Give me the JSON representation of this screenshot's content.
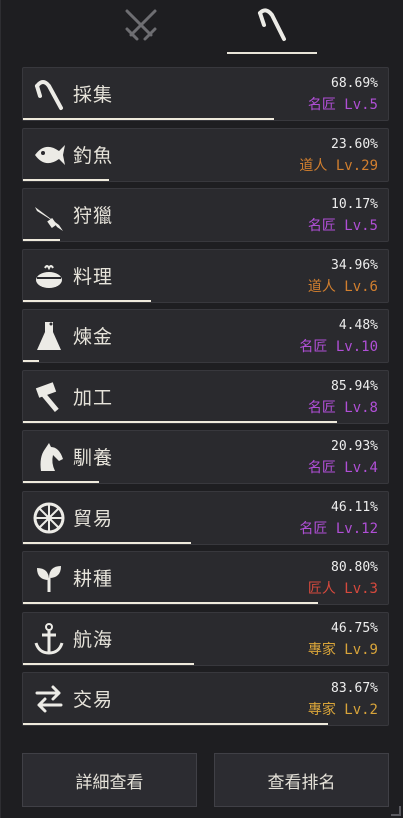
{
  "tabs": [
    {
      "icon": "crossed-swords-icon",
      "active": false
    },
    {
      "icon": "sickle-icon",
      "active": true
    }
  ],
  "skills": [
    {
      "name": "採集",
      "icon": "sickle-icon",
      "percent": "68.69%",
      "progress": 0.6869,
      "rank": "名匠 Lv.5",
      "rank_color": "#b04fd6"
    },
    {
      "name": "釣魚",
      "icon": "fish-icon",
      "percent": "23.60%",
      "progress": 0.236,
      "rank": "道人 Lv.29",
      "rank_color": "#d27f2e"
    },
    {
      "name": "狩獵",
      "icon": "musket-icon",
      "percent": "10.17%",
      "progress": 0.1017,
      "rank": "名匠 Lv.5",
      "rank_color": "#b04fd6"
    },
    {
      "name": "料理",
      "icon": "cooking-pot-icon",
      "percent": "34.96%",
      "progress": 0.3496,
      "rank": "道人 Lv.6",
      "rank_color": "#d27f2e"
    },
    {
      "name": "煉金",
      "icon": "flask-icon",
      "percent": "4.48%",
      "progress": 0.0448,
      "rank": "名匠 Lv.10",
      "rank_color": "#b04fd6"
    },
    {
      "name": "加工",
      "icon": "hammer-icon",
      "percent": "85.94%",
      "progress": 0.8594,
      "rank": "名匠 Lv.8",
      "rank_color": "#b04fd6"
    },
    {
      "name": "馴養",
      "icon": "horse-head-icon",
      "percent": "20.93%",
      "progress": 0.2093,
      "rank": "名匠 Lv.4",
      "rank_color": "#b04fd6"
    },
    {
      "name": "貿易",
      "icon": "wagon-wheel-icon",
      "percent": "46.11%",
      "progress": 0.4611,
      "rank": "名匠 Lv.12",
      "rank_color": "#b04fd6"
    },
    {
      "name": "耕種",
      "icon": "sprout-icon",
      "percent": "80.80%",
      "progress": 0.808,
      "rank": "匠人 Lv.3",
      "rank_color": "#d6493d"
    },
    {
      "name": "航海",
      "icon": "anchor-icon",
      "percent": "46.75%",
      "progress": 0.4675,
      "rank": "專家 Lv.9",
      "rank_color": "#d8a43a"
    },
    {
      "name": "交易",
      "icon": "exchange-arrows-icon",
      "percent": "83.67%",
      "progress": 0.8367,
      "rank": "專家 Lv.2",
      "rank_color": "#d8a43a"
    }
  ],
  "buttons": {
    "detail_label": "詳細查看",
    "ranking_label": "查看排名"
  }
}
